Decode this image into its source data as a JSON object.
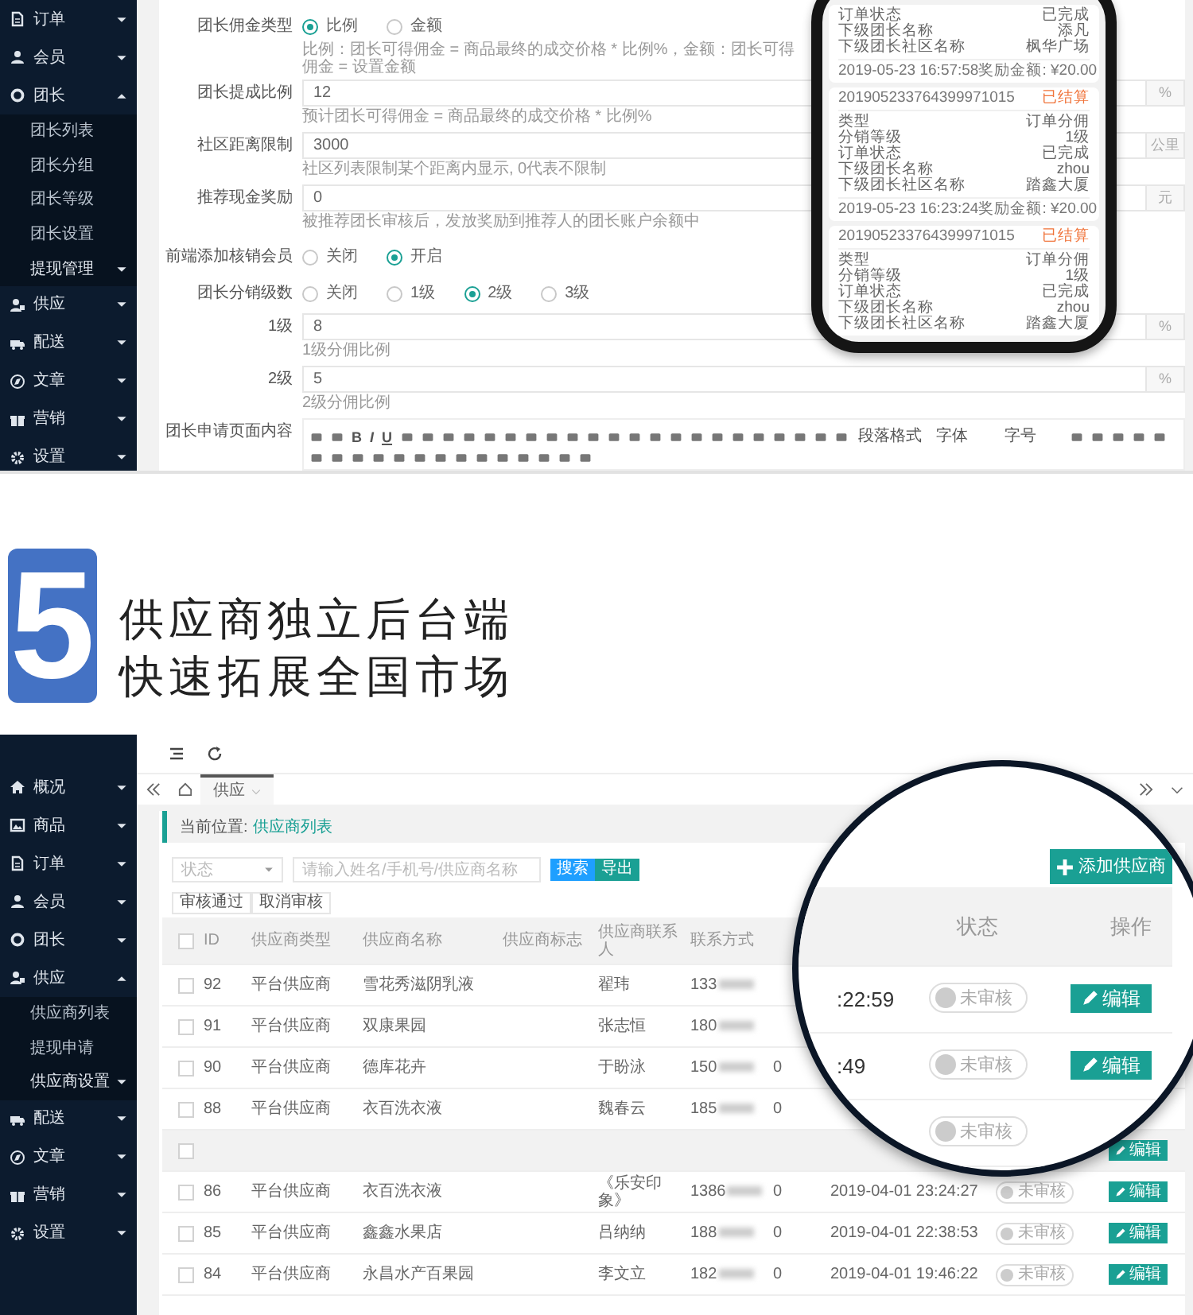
{
  "top_screen": {
    "sidebar": [
      {
        "label": "订单",
        "expanded": false
      },
      {
        "label": "会员",
        "expanded": false
      },
      {
        "label": "团长",
        "expanded": true,
        "children": [
          {
            "label": "团长列表",
            "kind": "link"
          },
          {
            "label": "团长分组",
            "kind": "link"
          },
          {
            "label": "团长等级",
            "kind": "link"
          },
          {
            "label": "团长设置",
            "kind": "link"
          },
          {
            "label": "提现管理",
            "kind": "group"
          }
        ]
      },
      {
        "label": "供应",
        "expanded": false
      },
      {
        "label": "配送",
        "expanded": false
      },
      {
        "label": "文章",
        "expanded": false
      },
      {
        "label": "营销",
        "expanded": false
      },
      {
        "label": "设置",
        "expanded": false
      }
    ],
    "form": [
      {
        "kind": "radio",
        "label": "团长佣金类型",
        "options": [
          {
            "label": "比例",
            "selected": true
          },
          {
            "label": "金额",
            "selected": false
          }
        ],
        "hint": "比例：团长可得佣金 = 商品最终的成交价格 * 比例%，金额：团长可得佣金 = 设置金额"
      },
      {
        "kind": "input",
        "label": "团长提成比例",
        "value": "12",
        "addon": "%",
        "hint": "预计团长可得佣金 = 商品最终的成交价格 * 比例%"
      },
      {
        "kind": "input",
        "label": "社区距离限制",
        "value": "3000",
        "addon": "公里",
        "hint": "社区列表限制某个距离内显示, 0代表不限制"
      },
      {
        "kind": "input",
        "label": "推荐现金奖励",
        "value": "0",
        "addon": "元",
        "hint": "被推荐团长审核后，发放奖励到推荐人的团长账户余额中"
      },
      {
        "kind": "radio",
        "label": "前端添加核销会员",
        "options": [
          {
            "label": "关闭",
            "selected": false
          },
          {
            "label": "开启",
            "selected": true
          }
        ]
      },
      {
        "kind": "radio",
        "label": "团长分销级数",
        "options": [
          {
            "label": "关闭",
            "selected": false
          },
          {
            "label": "1级",
            "selected": false
          },
          {
            "label": "2级",
            "selected": true
          },
          {
            "label": "3级",
            "selected": false
          }
        ]
      },
      {
        "kind": "input",
        "label": "1级",
        "value": "8",
        "addon": "%",
        "hint": "1级分佣比例"
      },
      {
        "kind": "input",
        "label": "2级",
        "value": "5",
        "addon": "%",
        "hint": "2级分佣比例"
      },
      {
        "kind": "editor",
        "label": "团长申请页面内容",
        "bold": "B",
        "italic": "I",
        "underline": "U",
        "dropdowns": [
          "段落格式",
          "字体",
          "字号"
        ]
      }
    ],
    "phone": {
      "cards": [
        {
          "rows": [
            {
              "key": "订单状态",
              "value": "已完成"
            },
            {
              "key": "下级团长名称",
              "value": "添凡"
            },
            {
              "key": "下级团长社区名称",
              "value": "枫华广场"
            }
          ],
          "footer": {
            "time": "2019-05-23 16:57:58",
            "reward": "奖励金额: ¥20.00"
          }
        },
        {
          "header": {
            "number": "201905233764399971015",
            "status": "已结算"
          },
          "rows": [
            {
              "key": "类型",
              "value": "订单分佣"
            },
            {
              "key": "分销等级",
              "value": "1级"
            },
            {
              "key": "订单状态",
              "value": "已完成"
            },
            {
              "key": "下级团长名称",
              "value": "zhou"
            },
            {
              "key": "下级团长社区名称",
              "value": "踏鑫大厦"
            }
          ],
          "footer": {
            "time": "2019-05-23 16:23:24",
            "reward": "奖励金额: ¥20.00"
          }
        },
        {
          "header": {
            "number": "201905233764399971015",
            "status": "已结算"
          },
          "rows": [
            {
              "key": "类型",
              "value": "订单分佣"
            },
            {
              "key": "分销等级",
              "value": "1级"
            },
            {
              "key": "订单状态",
              "value": "已完成"
            },
            {
              "key": "下级团长名称",
              "value": "zhou"
            },
            {
              "key": "下级团长社区名称",
              "value": "踏鑫大厦"
            }
          ]
        }
      ]
    }
  },
  "headline": {
    "number": "5",
    "lines": [
      "供应商独立后台端",
      "快速拓展全国市场"
    ]
  },
  "bottom_screen": {
    "sidebar": [
      {
        "label": "概况",
        "expanded": false
      },
      {
        "label": "商品",
        "expanded": false
      },
      {
        "label": "订单",
        "expanded": false
      },
      {
        "label": "会员",
        "expanded": false
      },
      {
        "label": "团长",
        "expanded": false
      },
      {
        "label": "供应",
        "expanded": true,
        "children": [
          {
            "label": "供应商列表",
            "kind": "link"
          },
          {
            "label": "提现申请",
            "kind": "link"
          },
          {
            "label": "供应商设置",
            "kind": "group"
          }
        ]
      },
      {
        "label": "配送",
        "expanded": false
      },
      {
        "label": "文章",
        "expanded": false
      },
      {
        "label": "营销",
        "expanded": false
      },
      {
        "label": "设置",
        "expanded": false
      }
    ],
    "tabs": [
      {
        "label": "供应",
        "selected": true
      }
    ],
    "breadcrumb": {
      "label": "当前位置:",
      "link": "供应商列表"
    },
    "filter": {
      "select": "状态",
      "search_placeholder": "请输入姓名/手机号/供应商名称",
      "buttons": [
        {
          "label": "搜索",
          "kind": "primary"
        },
        {
          "label": "导出",
          "kind": "export"
        }
      ]
    },
    "batch_buttons": [
      "审核通过",
      "取消审核"
    ],
    "table": {
      "header_checked": false,
      "columns": [
        "ID",
        "供应商类型",
        "供应商名称",
        "供应商标志",
        "供应商联系人",
        "联系方式"
      ],
      "rows": [
        {
          "checked": false,
          "id": "92",
          "type": "平台供应商",
          "name": "雪花秀滋阴乳液",
          "contact": "翟玮",
          "phone": "133"
        },
        {
          "checked": false,
          "id": "91",
          "type": "平台供应商",
          "name": "双康果园",
          "contact": "张志恒",
          "phone": "180"
        },
        {
          "checked": false,
          "id": "90",
          "type": "平台供应商",
          "name": "德库花卉",
          "contact": "于盼泳",
          "phone": "150",
          "balance": "0"
        },
        {
          "checked": false,
          "id": "88",
          "type": "平台供应商",
          "name": "衣百洗衣液",
          "contact": "魏春云",
          "phone": "185",
          "balance": "0"
        },
        {
          "checked": false,
          "action": "编辑"
        },
        {
          "checked": false,
          "id": "86",
          "type": "平台供应商",
          "name": "衣百洗衣液",
          "contact": "《乐安印象》",
          "phone": "1386",
          "balance": "0",
          "time": "2019-04-01 23:24:27",
          "status": "未审核",
          "status_on": false,
          "action": "编辑"
        },
        {
          "checked": false,
          "id": "85",
          "type": "平台供应商",
          "name": "鑫鑫水果店",
          "contact": "吕纳纳",
          "phone": "188",
          "balance": "0",
          "time": "2019-04-01 22:38:53",
          "status": "未审核",
          "status_on": false,
          "action": "编辑"
        },
        {
          "checked": false,
          "id": "84",
          "type": "平台供应商",
          "name": "永昌水产百果园",
          "contact": "李文立",
          "phone": "182",
          "balance": "0",
          "time": "2019-04-01 19:46:22",
          "status": "未审核",
          "status_on": false,
          "action": "编辑"
        }
      ]
    },
    "magnifier": {
      "add_button": "添加供应商",
      "columns": [
        "状态",
        "操作"
      ],
      "rows": [
        {
          "time": ":22:59",
          "status": "未审核",
          "status_on": false,
          "action": "编辑"
        },
        {
          "time": ":49",
          "status": "未审核",
          "status_on": false,
          "action": "编辑"
        },
        {
          "status": "未审核",
          "status_on": false
        }
      ]
    }
  }
}
